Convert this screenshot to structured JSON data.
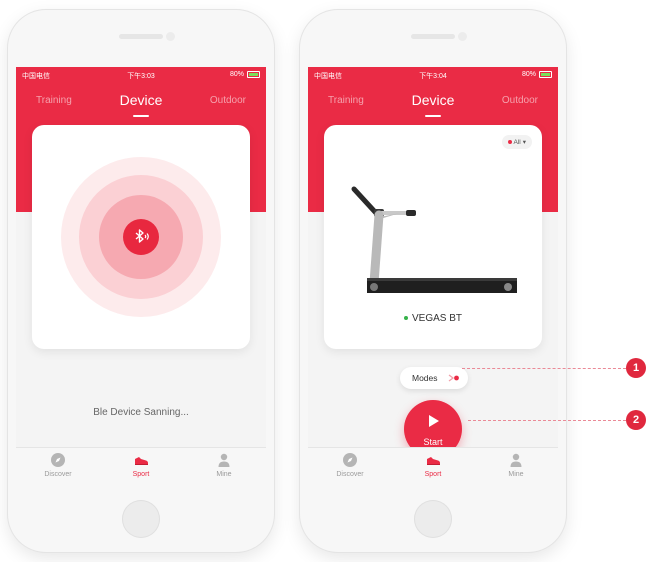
{
  "colors": {
    "brand_red": "#ea2b45",
    "status_green": "#36b24a"
  },
  "left_phone": {
    "status": {
      "carrier": "中国电信",
      "time": "下午3:03",
      "battery": "80%"
    },
    "tabs": [
      {
        "label": "Training"
      },
      {
        "label": "Device"
      },
      {
        "label": "Outdoor"
      }
    ],
    "active_tab": "Device",
    "scan_text": "Ble Device Sanning...",
    "nav": [
      {
        "label": "Discover",
        "icon": "compass-icon"
      },
      {
        "label": "Sport",
        "icon": "sneaker-icon"
      },
      {
        "label": "Mine",
        "icon": "person-icon"
      }
    ]
  },
  "right_phone": {
    "status": {
      "carrier": "中国电信",
      "time": "下午3:04",
      "battery": "80%"
    },
    "tabs": [
      {
        "label": "Training"
      },
      {
        "label": "Device"
      },
      {
        "label": "Outdoor"
      }
    ],
    "active_tab": "Device",
    "filter_label": "All",
    "device_name": "VEGAS BT",
    "modes_label": "Modes",
    "start_label": "Start",
    "nav": [
      {
        "label": "Discover",
        "icon": "compass-icon"
      },
      {
        "label": "Sport",
        "icon": "sneaker-icon"
      },
      {
        "label": "Mine",
        "icon": "person-icon"
      }
    ]
  },
  "callouts": [
    {
      "number": "1"
    },
    {
      "number": "2"
    }
  ]
}
